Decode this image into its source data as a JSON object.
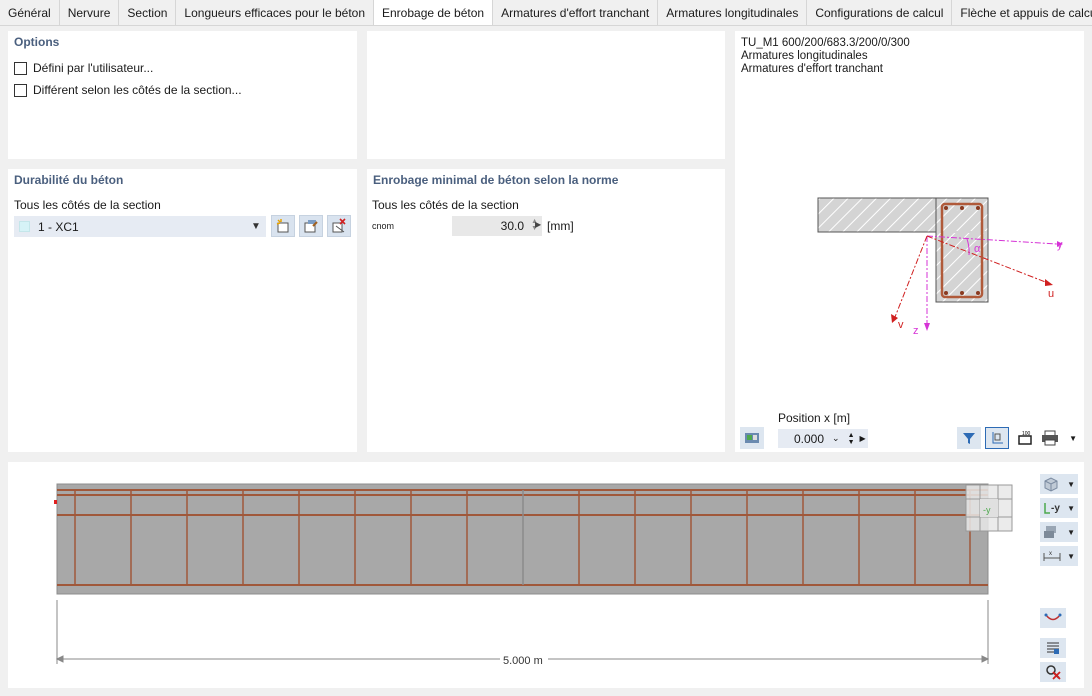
{
  "tabs": [
    {
      "label": "Général"
    },
    {
      "label": "Nervure"
    },
    {
      "label": "Section"
    },
    {
      "label": "Longueurs efficaces pour le béton"
    },
    {
      "label": "Enrobage de béton"
    },
    {
      "label": "Armatures d'effort tranchant"
    },
    {
      "label": "Armatures longitudinales"
    },
    {
      "label": "Configurations de calcul"
    },
    {
      "label": "Flèche et appuis de calcul"
    }
  ],
  "options": {
    "title": "Options",
    "user_defined": "Défini par l'utilisateur...",
    "different_sides": "Différent selon les côtés de la section..."
  },
  "durability": {
    "title": "Durabilité du béton",
    "sides_label": "Tous les côtés de la section",
    "selected": "1 - XC1"
  },
  "min_cover": {
    "title": "Enrobage minimal de béton selon la norme",
    "sides_label": "Tous les côtés de la section",
    "cnom_label": "cnom",
    "cnom_value": "30.0",
    "unit": "[mm]"
  },
  "section_view": {
    "section_name": "TU_M1 600/200/683.3/200/0/300",
    "line2": "Armatures longitudinales",
    "line3": "Armatures d'effort tranchant",
    "axis_y": "y",
    "axis_z": "z",
    "axis_u": "u",
    "axis_v": "v",
    "angle": "α",
    "position_label": "Position x [m]",
    "position_value": "0.000"
  },
  "beam_view": {
    "length_label": "5.000 m",
    "axis_label": "-y",
    "axis_button_label": "-y"
  }
}
